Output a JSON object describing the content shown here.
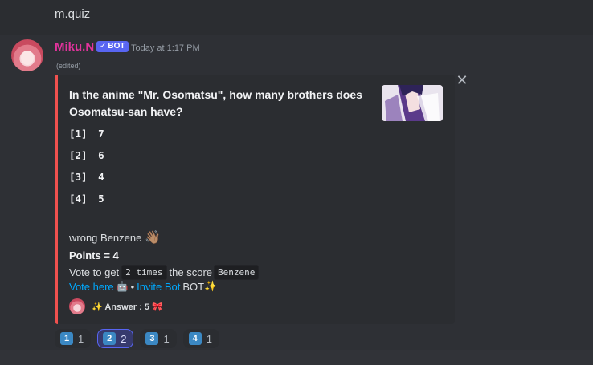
{
  "previous_message": {
    "text": "m.quiz"
  },
  "message": {
    "username": "Miku.N",
    "bot_tag": "BOT",
    "timestamp": "Today at 1:17 PM",
    "edited": "(edited)",
    "embed": {
      "accent_color": "#f0514f",
      "question": "In the anime \"Mr. Osomatsu\", how many brothers does Osomatsu-san have?",
      "choices": [
        {
          "label": "[1]",
          "value": "7"
        },
        {
          "label": "[2]",
          "value": "6"
        },
        {
          "label": "[3]",
          "value": "4"
        },
        {
          "label": "[4]",
          "value": "5"
        }
      ],
      "result_text": "wrong Benzene",
      "result_emoji": "👋🏽",
      "points": "Points = 4",
      "vote_prefix": "Vote to get",
      "vote_code": "2 times",
      "vote_middle": "the score",
      "vote_code_2": "Benzene",
      "vote_link": "Vote here",
      "vote_emoji": "🤖",
      "separator": "•",
      "invite_link": "Invite Bot",
      "bot_text": "BOT",
      "sparkle_emoji": "✨",
      "footer_text": "✨ Answer : 5 🎀"
    }
  },
  "reactions": [
    {
      "emoji": "1",
      "count": "1",
      "active": false
    },
    {
      "emoji": "2",
      "count": "2",
      "active": true
    },
    {
      "emoji": "3",
      "count": "1",
      "active": false
    },
    {
      "emoji": "4",
      "count": "1",
      "active": false
    }
  ],
  "icons": {
    "close": "close-icon",
    "check": "check-icon"
  }
}
